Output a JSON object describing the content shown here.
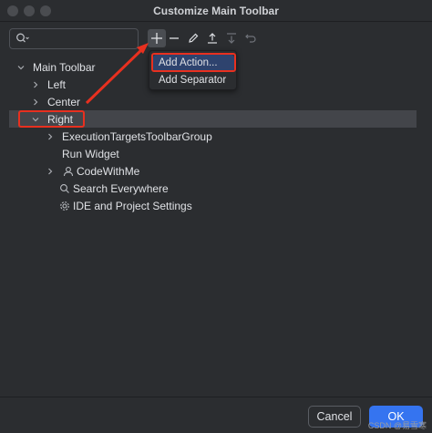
{
  "window": {
    "title": "Customize Main Toolbar"
  },
  "search": {
    "placeholder": ""
  },
  "toolbar": {
    "icons": [
      "plus-icon",
      "minus-icon",
      "edit-icon",
      "move-up-icon",
      "move-down-icon",
      "restore-icon"
    ]
  },
  "popup": {
    "items": [
      {
        "label": "Add Action..."
      },
      {
        "label": "Add Separator"
      }
    ]
  },
  "tree": {
    "rows": [
      {
        "label": "Main Toolbar",
        "expanded": true
      },
      {
        "label": "Left",
        "expanded": false
      },
      {
        "label": "Center",
        "expanded": false
      },
      {
        "label": "Right",
        "expanded": true,
        "selected": true
      },
      {
        "label": "ExecutionTargetsToolbarGroup",
        "expanded": false
      },
      {
        "label": "Run Widget"
      },
      {
        "label": "CodeWithMe",
        "icon": "user-icon",
        "expanded": false
      },
      {
        "label": "Search Everywhere",
        "icon": "search-icon"
      },
      {
        "label": "IDE and Project Settings",
        "icon": "gear-icon"
      }
    ]
  },
  "footer": {
    "cancel_label": "Cancel",
    "ok_label": "OK"
  },
  "watermark": "CSDN @易雪寒",
  "colors": {
    "accent": "#3574f0",
    "annotation": "#e8301f",
    "selection": "#43454a",
    "popup_highlight": "#2e436e"
  }
}
